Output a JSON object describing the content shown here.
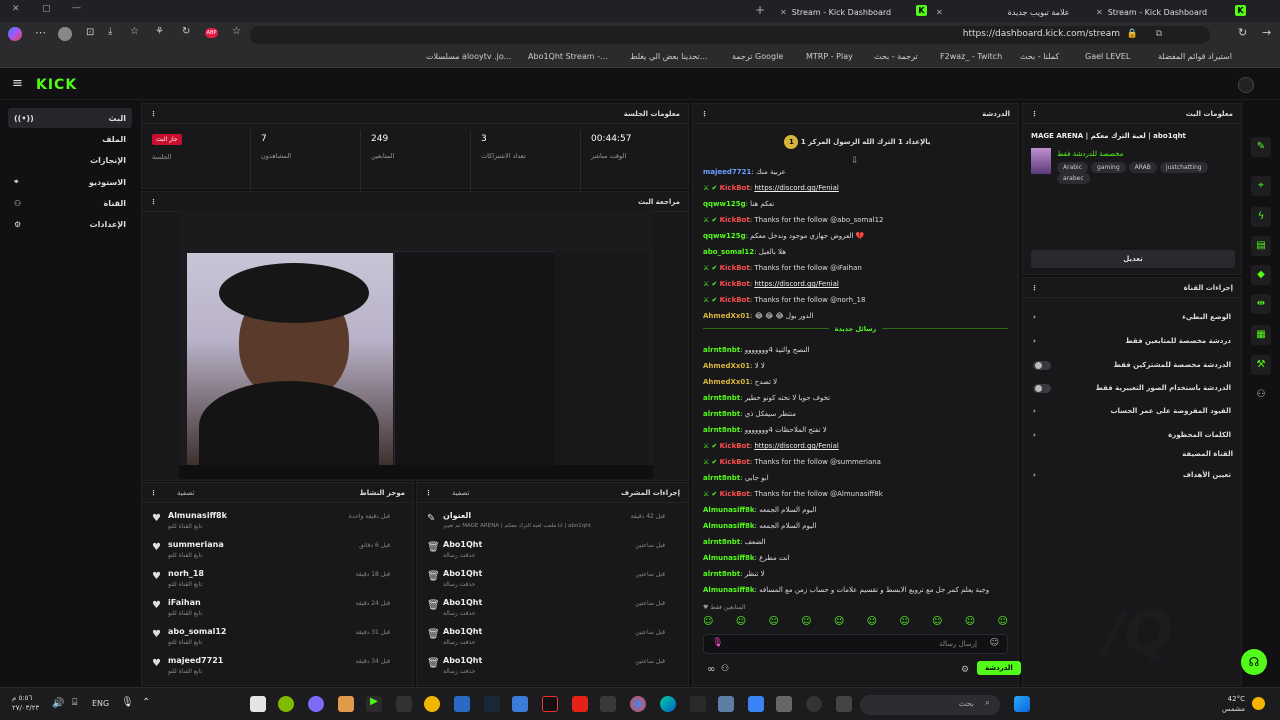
{
  "browser": {
    "tabs": [
      {
        "title": "Stream - Kick Dashboard"
      },
      {
        "title": "علامة تبويب جديدة"
      },
      {
        "title": "Stream - Kick Dashboard"
      }
    ],
    "url": "https://dashboard.kick.com/stream",
    "bookmarks": [
      "استيراد قوائم المفضلة",
      "Gael LEVEL",
      "كملنا - بحث",
      "F2waz_ - Twitch",
      "ترجمة - بحث",
      "MTRP - Play",
      "ترجمة Google",
      "تحدينا بعض الي يغلط...",
      "Abo1Qht Stream -...",
      "مسلسلات alooytv .jo..."
    ]
  },
  "app": {
    "logo": "KICK",
    "sidebar": [
      {
        "label": "البث",
        "icon": "live-icon",
        "active": true
      },
      {
        "label": "الملف",
        "icon": "profile-icon"
      },
      {
        "label": "الإنجازات",
        "icon": "trophy-icon"
      },
      {
        "label": "الاستوديو",
        "icon": "studio-icon"
      },
      {
        "label": "القناة",
        "icon": "channel-icon"
      },
      {
        "label": "الإعدادات",
        "icon": "settings-icon"
      }
    ],
    "session": {
      "title": "معلومات الجلسة",
      "badge": "جار البث",
      "badge_label": "الجلسة",
      "stats": [
        {
          "value": "7",
          "label": "المشاهدون"
        },
        {
          "value": "249",
          "label": "المتابعين"
        },
        {
          "value": "3",
          "label": "تعداد الاشتراكات"
        },
        {
          "value": "00:44:57",
          "label": "الوقت مباشر"
        }
      ]
    },
    "preview_title": "مراجعة البث",
    "activity": {
      "title": "موجز النشاط",
      "filter": "تصفية",
      "items": [
        {
          "name": "Almunasiff8k",
          "sub": "تابع القناة للتو",
          "time": "قبل دقيقة واحدة"
        },
        {
          "name": "summeriana",
          "sub": "تابع القناة للتو",
          "time": "قبل 6 دقائق"
        },
        {
          "name": "norh_18",
          "sub": "تابع القناة للتو",
          "time": "قبل 18 دقيقة"
        },
        {
          "name": "iFaihan",
          "sub": "تابع القناة للتو",
          "time": "قبل 24 دقيقة"
        },
        {
          "name": "abo_somal12",
          "sub": "تابع القناة للتو",
          "time": "قبل 31 دقيقة"
        },
        {
          "name": "majeed7721",
          "sub": "تابع القناة للتو",
          "time": "قبل 34 دقيقة"
        }
      ]
    },
    "mod": {
      "title": "إجراءات المشرف",
      "filter": "تصفية",
      "items": [
        {
          "name": "العنوان",
          "sub": "تم تغيير MAGE ARENA | انا ملعب لعبة الترك معكم | abo1qht",
          "time": "قبل 42 دقيقة"
        },
        {
          "name": "Abo1Qht",
          "sub": "حذفت رسالة",
          "time": "قبل ساعتين"
        },
        {
          "name": "Abo1Qht",
          "sub": "حذفت رسالة",
          "time": "قبل ساعتين"
        },
        {
          "name": "Abo1Qht",
          "sub": "حذفت رسالة",
          "time": "قبل ساعتين"
        },
        {
          "name": "Abo1Qht",
          "sub": "حذفت رسالة",
          "time": "قبل ساعتين"
        },
        {
          "name": "Abo1Qht",
          "sub": "حذفت رسالة",
          "time": "قبل ساعتين"
        }
      ]
    },
    "chat": {
      "title": "الدردشة",
      "pinned": "بالإعداد 1 الترك الله الرسول المركز 1",
      "new_messages": "رسائل جديدة",
      "messages": [
        {
          "user": "majeed7721",
          "color": "#6aa0ff",
          "text": "عربية منك"
        },
        {
          "user": "KickBot",
          "bot": true,
          "text": "https://discord.gg/Fenial",
          "link": true
        },
        {
          "user": "qqww125g",
          "color": "#53fc18",
          "text": "نعكم هنا"
        },
        {
          "user": "KickBot",
          "bot": true,
          "text": "Thanks for the follow @abo_somal12"
        },
        {
          "user": "qqww125g",
          "color": "#53fc18",
          "text": "العروض جهازي موجود وندخل معكم 💔"
        },
        {
          "user": "abo_somal12",
          "color": "#53fc18",
          "text": "هلا بالغيل"
        },
        {
          "user": "KickBot",
          "bot": true,
          "text": "Thanks for the follow @iFaihan"
        },
        {
          "user": "KickBot",
          "bot": true,
          "text": "https://discord.gg/Fenial",
          "link": true
        },
        {
          "user": "KickBot",
          "bot": true,
          "text": "Thanks for the follow @norh_18"
        },
        {
          "user": "AhmedXx01",
          "color": "#d9b43a",
          "text": "😂 😂 😂 الدور بول"
        },
        {
          "user": "alrnt8nbt",
          "color": "#53fc18",
          "text": "النصح والنية 4ووووووو"
        },
        {
          "user": "AhmedXx01",
          "color": "#d9b43a",
          "text": "لا لا"
        },
        {
          "user": "AhmedXx01",
          "color": "#d9b43a",
          "text": "لا تصدح"
        },
        {
          "user": "alrnt8nbt",
          "color": "#53fc18",
          "text": "تخوف جويا لا نخته كونو خطير"
        },
        {
          "user": "alrnt8nbt",
          "color": "#53fc18",
          "text": "منتظر سيفكل ذي"
        },
        {
          "user": "alrnt8nbt",
          "color": "#53fc18",
          "text": "لا تفتح الملاحظات 4ووووووو"
        },
        {
          "user": "KickBot",
          "bot": true,
          "text": "https://discord.gg/Fenial",
          "link": true
        },
        {
          "user": "KickBot",
          "bot": true,
          "text": "Thanks for the follow @summeriana"
        },
        {
          "user": "alrnt8nbt",
          "color": "#53fc18",
          "text": "ابو جابي"
        },
        {
          "user": "KickBot",
          "bot": true,
          "text": "Thanks for the follow @Almunasiff8k"
        },
        {
          "user": "Almunasiff8k",
          "color": "#53fc18",
          "text": "اليوم السلام الجمعه"
        },
        {
          "user": "Almunasiff8k",
          "color": "#53fc18",
          "text": "اليوم السلام الجمعه"
        },
        {
          "user": "alrnt8nbt",
          "color": "#53fc18",
          "text": "الضعف"
        },
        {
          "user": "Almunasiff8k",
          "color": "#53fc18",
          "text": "انت مطرع"
        },
        {
          "user": "alrnt8nbt",
          "color": "#53fc18",
          "text": "لا تنظر"
        },
        {
          "user": "Almunasiff8k",
          "color": "#53fc18",
          "text": "وجبة يعلم كمر جل مع ترويع الابسط و تقسيم علامات و حساب زمن مع المسافه"
        }
      ],
      "typing": "المتابعين فقط",
      "input_placeholder": "إرسال رسالة",
      "send": "الدردشة"
    },
    "stream_info": {
      "title": "معلومات البث",
      "stream_title": "MAGE ARENA | لعبة الترك معكم | abo1qht",
      "category": "مخصصة للدردشة فقط",
      "tags": [
        "Arabic",
        "gaming",
        "ARAB",
        "justchatting",
        "arabec"
      ],
      "edit": "تعديل"
    },
    "channel_actions": {
      "title": "إجراءات القناة",
      "rows": [
        {
          "label": "الوضع البطيء",
          "type": "chevron"
        },
        {
          "label": "دردشة مخصصة للمتابعين فقط",
          "type": "chevron"
        },
        {
          "label": "الدردشة مخصصة للمشتركين فقط",
          "type": "toggle"
        },
        {
          "label": "الدردشة باستخدام الصور التعبيرية فقط",
          "type": "toggle"
        },
        {
          "label": "القيود المفروضة على عمر الحساب",
          "type": "chevron"
        },
        {
          "label": "الكلمات المحظورة",
          "type": "chevron"
        }
      ],
      "section": "القناة المضيفة",
      "host_row": "تعيين الأهداف"
    }
  },
  "taskbar": {
    "time": "٥:٥٦ م",
    "date": "٢٧/٠٣/٢٣",
    "lang": "ENG",
    "search_placeholder": "بحث",
    "weather": "42°C",
    "weather_label": "مشمس"
  }
}
